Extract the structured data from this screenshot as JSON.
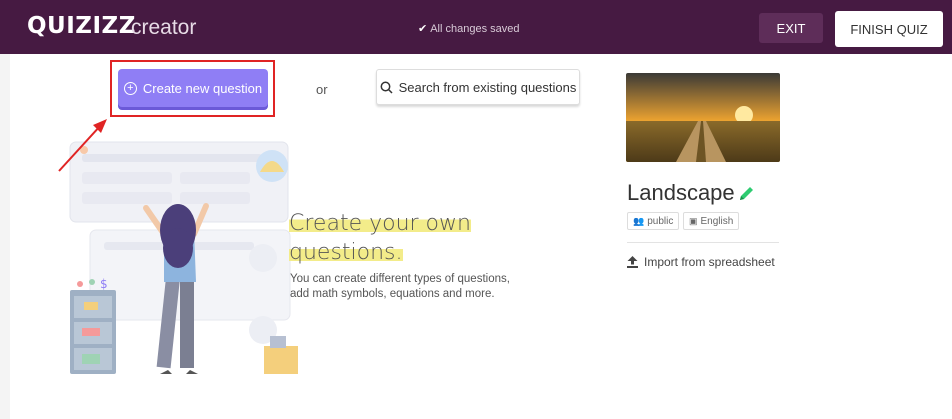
{
  "header": {
    "logo": "QUIZIZZ",
    "logo_sub": "creator",
    "saved_status": "All changes saved",
    "exit_label": "EXIT",
    "finish_label": "FINISH QUIZ"
  },
  "main": {
    "create_label": "Create new question",
    "or_label": "or",
    "search_label": "Search from existing questions",
    "headline_line1": "Create your own",
    "headline_line2": "questions.",
    "description": "You can create different types of questions, add math symbols, equations and more."
  },
  "quiz": {
    "title": "Landscape",
    "visibility": "public",
    "language": "English",
    "import_label": "Import from spreadsheet"
  },
  "colors": {
    "topbar": "#461a42",
    "primary_button": "#8f7ef5",
    "annotation_red": "#e02424",
    "highlight": "#f3ec8a",
    "pencil": "#2ecc71"
  },
  "icons": {
    "saved": "check-icon",
    "create": "plus-circle-icon",
    "search": "search-icon",
    "edit": "pencil-icon",
    "visibility": "users-icon",
    "language": "language-icon",
    "import": "upload-icon"
  }
}
